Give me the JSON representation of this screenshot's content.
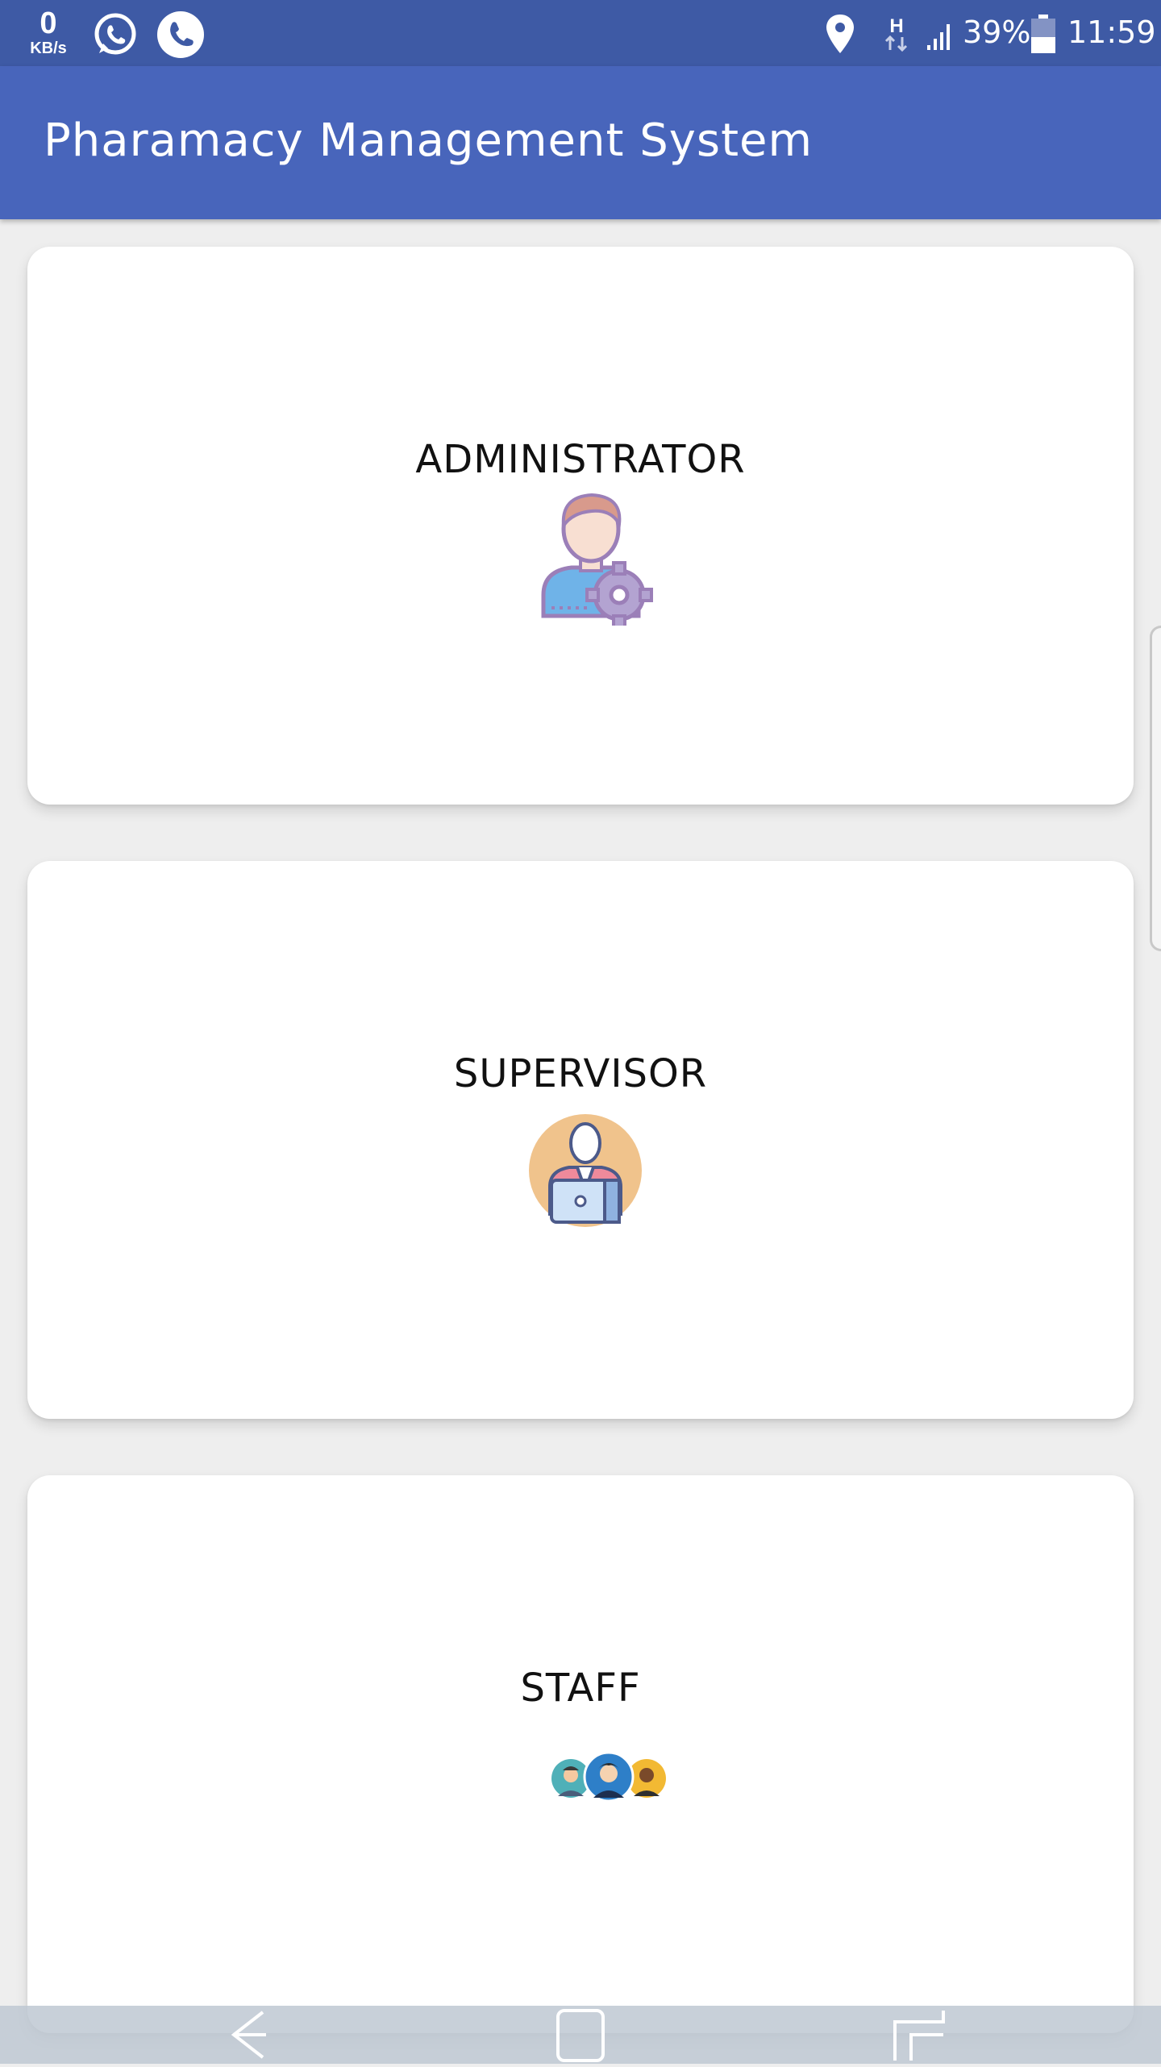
{
  "status_bar": {
    "net_speed_value": "0",
    "net_speed_unit": "KB/s",
    "battery": "39%",
    "time": "11:59",
    "network_type": "H",
    "icons": [
      "whatsapp-icon",
      "phone-icon",
      "location-icon",
      "network-h-icon",
      "signal-icon",
      "battery-icon"
    ]
  },
  "app_bar": {
    "title": "Pharamacy Management System"
  },
  "cards": [
    {
      "label": "ADMINISTRATOR",
      "icon": "admin-gear-icon"
    },
    {
      "label": "SUPERVISOR",
      "icon": "supervisor-laptop-icon"
    },
    {
      "label": "STAFF",
      "icon": "staff-group-icon"
    }
  ],
  "nav_bar": {
    "buttons": [
      "back-icon",
      "home-icon",
      "recents-icon"
    ]
  },
  "colors": {
    "status_bar": "#3e5aa5",
    "app_bar": "#4865bb",
    "background": "#eeeeee",
    "card": "#ffffff"
  }
}
